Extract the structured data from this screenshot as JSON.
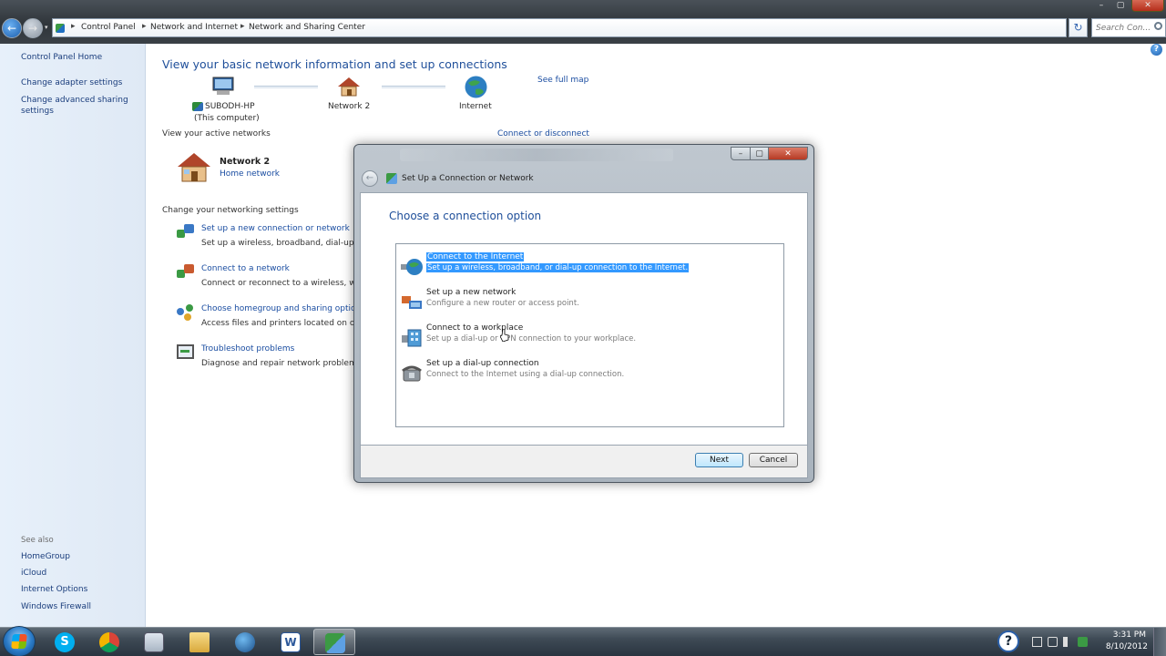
{
  "window": {
    "breadcrumb": [
      "Control Panel",
      "Network and Internet",
      "Network and Sharing Center"
    ],
    "search_placeholder": "Search Con...",
    "controls": {
      "minimize": "–",
      "maximize": "▢",
      "close": "✕"
    }
  },
  "sidebar": {
    "items": [
      {
        "label": "Control Panel Home"
      },
      {
        "label": "Change adapter settings"
      },
      {
        "label": "Change advanced sharing settings"
      }
    ],
    "see_also_label": "See also",
    "see_also": [
      {
        "label": "HomeGroup"
      },
      {
        "label": "iCloud"
      },
      {
        "label": "Internet Options"
      },
      {
        "label": "Windows Firewall"
      }
    ]
  },
  "main": {
    "heading": "View your basic network information and set up connections",
    "map": {
      "computer_name": "SUBODH-HP",
      "computer_sub": "(This computer)",
      "network": "Network  2",
      "internet": "Internet",
      "see_full_map": "See full map"
    },
    "active_networks_label": "View your active networks",
    "connect_or_disconnect": "Connect or disconnect",
    "active_network": {
      "name": "Network  2",
      "type": "Home network"
    },
    "settings_label": "Change your networking settings",
    "tasks": [
      {
        "title": "Set up a new connection or network",
        "desc": "Set up a wireless, broadband, dial-up, ad",
        "icon": "setup-network-icon"
      },
      {
        "title": "Connect to a network",
        "desc": "Connect or reconnect to a wireless, wire",
        "icon": "connect-network-icon"
      },
      {
        "title": "Choose homegroup and sharing optio",
        "desc": "Access files and printers located on othe",
        "icon": "homegroup-icon"
      },
      {
        "title": "Troubleshoot problems",
        "desc": "Diagnose and repair network problems,",
        "icon": "troubleshoot-icon"
      }
    ]
  },
  "dialog": {
    "title": "Set Up a Connection or Network",
    "heading": "Choose a connection option",
    "options": [
      {
        "title": "Connect to the Internet",
        "desc": "Set up a wireless, broadband, or dial-up connection to the Internet.",
        "selected": true,
        "icon": "globe-icon"
      },
      {
        "title": "Set up a new network",
        "desc": "Configure a new router or access point.",
        "selected": false,
        "icon": "router-icon"
      },
      {
        "title": "Connect to a workplace",
        "desc": "Set up a dial-up or VPN connection to your workplace.",
        "selected": false,
        "icon": "workplace-icon"
      },
      {
        "title": "Set up a dial-up connection",
        "desc": "Connect to the Internet using a dial-up connection.",
        "selected": false,
        "icon": "phone-icon"
      }
    ],
    "next_label": "Next",
    "cancel_label": "Cancel",
    "controls": {
      "minimize": "–",
      "maximize": "▢",
      "close": "✕"
    }
  },
  "taskbar": {
    "apps": [
      "skype-icon",
      "chrome-icon",
      "calculator-icon",
      "explorer-icon",
      "network-icon",
      "word-icon",
      "control-panel-icon"
    ],
    "time": "3:31 PM",
    "date": "8/10/2012"
  },
  "colors": {
    "link": "#1a4da1",
    "heading": "#1f4f9a",
    "selection": "#3399ff",
    "sidebar_bg": "#e3edf8"
  }
}
